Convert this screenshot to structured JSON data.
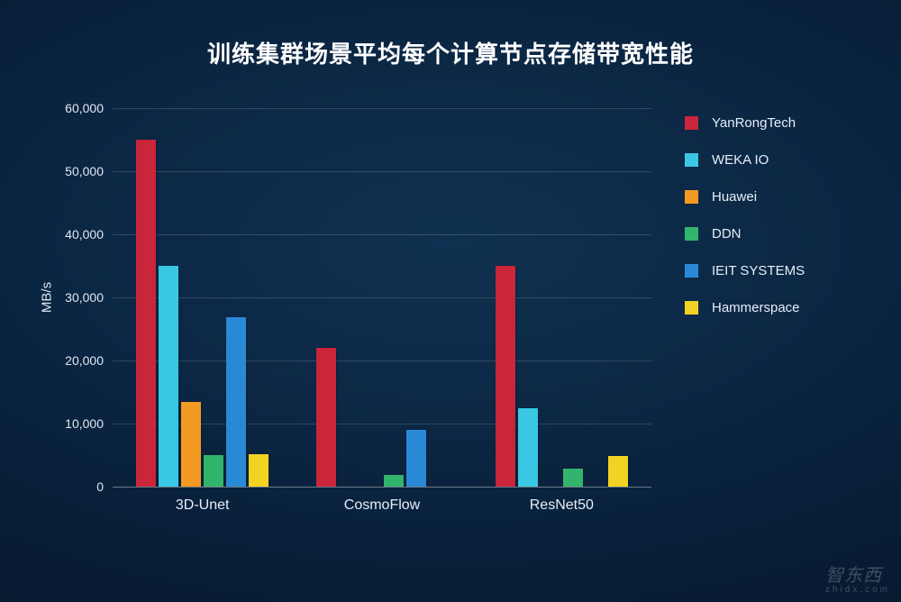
{
  "title": "训练集群场景平均每个计算节点存储带宽性能",
  "ylabel": "MB/s",
  "watermark_main": "智东西",
  "watermark_sub": "zhidx.com",
  "chart_data": {
    "type": "bar",
    "title": "训练集群场景平均每个计算节点存储带宽性能",
    "xlabel": "",
    "ylabel": "MB/s",
    "ylim": [
      0,
      60000
    ],
    "yticks": [
      0,
      10000,
      20000,
      30000,
      40000,
      50000,
      60000
    ],
    "ytick_labels": [
      "0",
      "10,000",
      "20,000",
      "30,000",
      "40,000",
      "50,000",
      "60,000"
    ],
    "categories": [
      "3D-Unet",
      "CosmoFlow",
      "ResNet50"
    ],
    "series": [
      {
        "name": "YanRongTech",
        "color": "#c9253b",
        "values": [
          55000,
          22000,
          35000
        ]
      },
      {
        "name": "WEKA IO",
        "color": "#39c7e3",
        "values": [
          35000,
          null,
          12500
        ]
      },
      {
        "name": "Huawei",
        "color": "#f29a22",
        "values": [
          13500,
          null,
          null
        ]
      },
      {
        "name": "DDN",
        "color": "#33b46d",
        "values": [
          5000,
          1800,
          2800
        ]
      },
      {
        "name": "IEIT SYSTEMS",
        "color": "#2a89d6",
        "values": [
          26800,
          9000,
          null
        ]
      },
      {
        "name": "Hammerspace",
        "color": "#f2d324",
        "values": [
          5200,
          null,
          4800
        ]
      }
    ],
    "legend_position": "right"
  }
}
